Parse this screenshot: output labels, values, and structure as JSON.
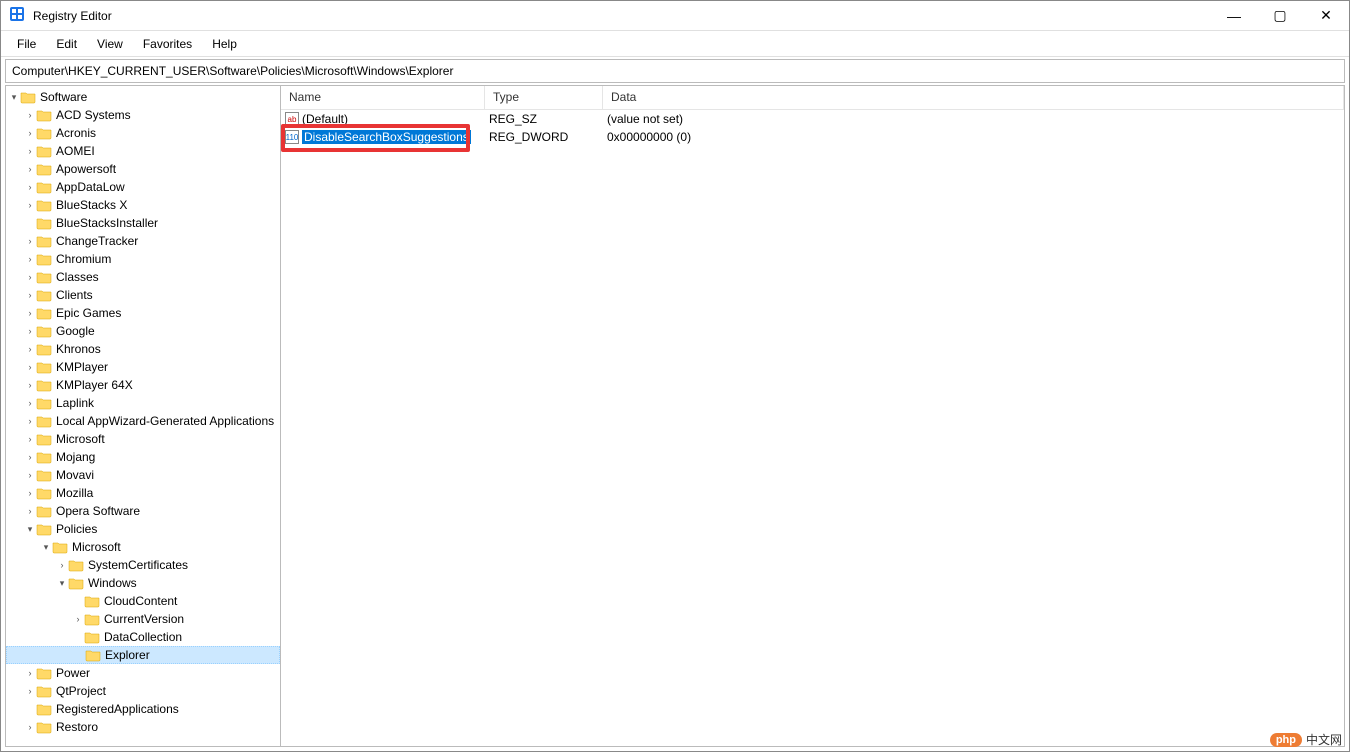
{
  "window": {
    "title": "Registry Editor"
  },
  "menu": [
    "File",
    "Edit",
    "View",
    "Favorites",
    "Help"
  ],
  "address": "Computer\\HKEY_CURRENT_USER\\Software\\Policies\\Microsoft\\Windows\\Explorer",
  "tree": [
    {
      "label": "Software",
      "level": 0,
      "expander": "▾"
    },
    {
      "label": "ACD Systems",
      "level": 1,
      "expander": "›"
    },
    {
      "label": "Acronis",
      "level": 1,
      "expander": "›"
    },
    {
      "label": "AOMEI",
      "level": 1,
      "expander": "›"
    },
    {
      "label": "Apowersoft",
      "level": 1,
      "expander": "›"
    },
    {
      "label": "AppDataLow",
      "level": 1,
      "expander": "›"
    },
    {
      "label": "BlueStacks X",
      "level": 1,
      "expander": "›"
    },
    {
      "label": "BlueStacksInstaller",
      "level": 1,
      "expander": ""
    },
    {
      "label": "ChangeTracker",
      "level": 1,
      "expander": "›"
    },
    {
      "label": "Chromium",
      "level": 1,
      "expander": "›"
    },
    {
      "label": "Classes",
      "level": 1,
      "expander": "›"
    },
    {
      "label": "Clients",
      "level": 1,
      "expander": "›"
    },
    {
      "label": "Epic Games",
      "level": 1,
      "expander": "›"
    },
    {
      "label": "Google",
      "level": 1,
      "expander": "›"
    },
    {
      "label": "Khronos",
      "level": 1,
      "expander": "›"
    },
    {
      "label": "KMPlayer",
      "level": 1,
      "expander": "›"
    },
    {
      "label": "KMPlayer 64X",
      "level": 1,
      "expander": "›"
    },
    {
      "label": "Laplink",
      "level": 1,
      "expander": "›"
    },
    {
      "label": "Local AppWizard-Generated Applications",
      "level": 1,
      "expander": "›"
    },
    {
      "label": "Microsoft",
      "level": 1,
      "expander": "›"
    },
    {
      "label": "Mojang",
      "level": 1,
      "expander": "›"
    },
    {
      "label": "Movavi",
      "level": 1,
      "expander": "›"
    },
    {
      "label": "Mozilla",
      "level": 1,
      "expander": "›"
    },
    {
      "label": "Opera Software",
      "level": 1,
      "expander": "›"
    },
    {
      "label": "Policies",
      "level": 1,
      "expander": "▾"
    },
    {
      "label": "Microsoft",
      "level": 2,
      "expander": "▾"
    },
    {
      "label": "SystemCertificates",
      "level": 3,
      "expander": "›"
    },
    {
      "label": "Windows",
      "level": 3,
      "expander": "▾"
    },
    {
      "label": "CloudContent",
      "level": 4,
      "expander": ""
    },
    {
      "label": "CurrentVersion",
      "level": 4,
      "expander": "›"
    },
    {
      "label": "DataCollection",
      "level": 4,
      "expander": ""
    },
    {
      "label": "Explorer",
      "level": 4,
      "expander": "",
      "selected": true
    },
    {
      "label": "Power",
      "level": 1,
      "expander": "›"
    },
    {
      "label": "QtProject",
      "level": 1,
      "expander": "›"
    },
    {
      "label": "RegisteredApplications",
      "level": 1,
      "expander": ""
    },
    {
      "label": "Restoro",
      "level": 1,
      "expander": "›"
    }
  ],
  "columns": {
    "name": "Name",
    "type": "Type",
    "data": "Data"
  },
  "values": [
    {
      "name": "(Default)",
      "type": "REG_SZ",
      "data": "(value not set)",
      "icon": "sz",
      "iconText": "ab",
      "selected": false
    },
    {
      "name": "DisableSearchBoxSuggestions",
      "type": "REG_DWORD",
      "data": "0x00000000 (0)",
      "icon": "dw",
      "iconText": "110",
      "selected": true
    }
  ],
  "watermark": {
    "php": "php",
    "label": "中文网"
  }
}
